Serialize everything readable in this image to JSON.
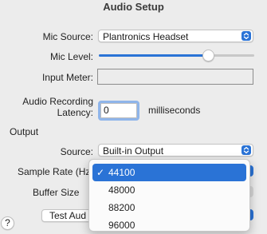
{
  "window": {
    "title": "Audio Setup"
  },
  "mic": {
    "source_label": "Mic Source:",
    "source_value": "Plantronics Headset",
    "level_label": "Mic Level:",
    "level_fraction": 0.72,
    "meter_label": "Input Meter:"
  },
  "latency": {
    "label_line1": "Audio Recording",
    "label_line2": "Latency:",
    "value": "0",
    "unit": "milliseconds"
  },
  "output": {
    "section_label": "Output",
    "source_label": "Source:",
    "source_value": "Built-in Output",
    "sample_rate_label": "Sample Rate (Hz)",
    "buffer_size_label": "Buffer Size",
    "test_button_label": "Test Aud"
  },
  "sample_rate_menu": {
    "options": [
      "44100",
      "48000",
      "88200",
      "96000"
    ],
    "selected": "44100",
    "check_mark": "✓"
  },
  "help": {
    "label": "?"
  },
  "colors": {
    "accent": "#2a73d6",
    "background": "#ececec"
  }
}
